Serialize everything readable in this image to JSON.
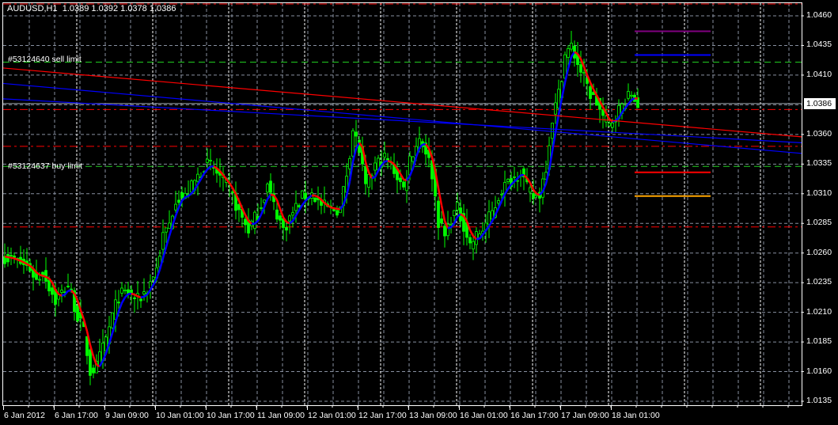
{
  "header": {
    "symbol": "AUDUSD,H1",
    "open": "1.0389",
    "high": "1.0392",
    "low": "1.0378",
    "close": "1.0386"
  },
  "orders": [
    {
      "label": "#53124640 sell limit",
      "price": 1.0421,
      "color": "#22cc22"
    },
    {
      "label": "#53124637 buy limit",
      "price": 1.0333,
      "color": "#22cc22"
    }
  ],
  "current_price": "1.0386",
  "colors": {
    "bull": "#00ff00",
    "ma_up": "#0000ff",
    "ma_down": "#ff0000",
    "grid": "#8890a0",
    "separator": "#ffffff"
  },
  "chart_data": {
    "type": "candlestick",
    "title": "AUDUSD,H1",
    "timeframe_hours": 1,
    "ylim": [
      1.0125,
      1.0471
    ],
    "y_ticks": [
      "1.0460",
      "1.0435",
      "1.0410",
      "1.0385",
      "1.0360",
      "1.0335",
      "1.0310",
      "1.0285",
      "1.0260",
      "1.0235",
      "1.0210",
      "1.0185",
      "1.0160",
      "1.0135"
    ],
    "y_tick_labels": [
      "1.0460",
      "1.0435",
      "1.0410",
      "1.0360",
      "1.0335",
      "1.0310",
      "1.0285",
      "1.0260",
      "1.0235",
      "1.0210",
      "1.0185",
      "1.0160",
      "1.0135"
    ],
    "x_tick_labels": [
      "6 Jan 2012",
      "6 Jan 17:00",
      "9 Jan 09:00",
      "10 Jan 01:00",
      "10 Jan 17:00",
      "11 Jan 09:00",
      "12 Jan 01:00",
      "12 Jan 17:00",
      "13 Jan 09:00",
      "16 Jan 01:00",
      "16 Jan 17:00",
      "17 Jan 09:00",
      "18 Jan 01:00"
    ],
    "close_path_bar_price": [
      [
        0,
        1.0257
      ],
      [
        4,
        1.0253
      ],
      [
        8,
        1.0247
      ],
      [
        10,
        1.0237
      ],
      [
        12,
        1.0244
      ],
      [
        16,
        1.022
      ],
      [
        20,
        1.0233
      ],
      [
        23,
        1.0207
      ],
      [
        25,
        1.0193
      ],
      [
        27,
        1.016
      ],
      [
        29,
        1.0164
      ],
      [
        32,
        1.0187
      ],
      [
        34,
        1.0207
      ],
      [
        36,
        1.0224
      ],
      [
        39,
        1.0227
      ],
      [
        42,
        1.022
      ],
      [
        45,
        1.023
      ],
      [
        48,
        1.0247
      ],
      [
        50,
        1.0274
      ],
      [
        52,
        1.0284
      ],
      [
        54,
        1.0307
      ],
      [
        57,
        1.0307
      ],
      [
        60,
        1.032
      ],
      [
        63,
        1.0334
      ],
      [
        65,
        1.0334
      ],
      [
        68,
        1.0324
      ],
      [
        71,
        1.0314
      ],
      [
        74,
        1.0294
      ],
      [
        77,
        1.028
      ],
      [
        80,
        1.0294
      ],
      [
        83,
        1.0317
      ],
      [
        85,
        1.03
      ],
      [
        88,
        1.028
      ],
      [
        91,
        1.0294
      ],
      [
        94,
        1.0307
      ],
      [
        97,
        1.031
      ],
      [
        100,
        1.03
      ],
      [
        103,
        1.0297
      ],
      [
        106,
        1.0297
      ],
      [
        108,
        1.0327
      ],
      [
        110,
        1.0364
      ],
      [
        112,
        1.0347
      ],
      [
        114,
        1.0314
      ],
      [
        117,
        1.0334
      ],
      [
        120,
        1.034
      ],
      [
        123,
        1.033
      ],
      [
        126,
        1.0314
      ],
      [
        128,
        1.034
      ],
      [
        131,
        1.0357
      ],
      [
        133,
        1.0347
      ],
      [
        135,
        1.0327
      ],
      [
        137,
        1.0287
      ],
      [
        139,
        1.0274
      ],
      [
        141,
        1.029
      ],
      [
        143,
        1.0297
      ],
      [
        145,
        1.0284
      ],
      [
        147,
        1.0267
      ],
      [
        149,
        1.0274
      ],
      [
        151,
        1.028
      ],
      [
        154,
        1.0294
      ],
      [
        157,
        1.0314
      ],
      [
        161,
        1.0324
      ],
      [
        163,
        1.033
      ],
      [
        165,
        1.0314
      ],
      [
        167,
        1.0307
      ],
      [
        169,
        1.031
      ],
      [
        171,
        1.0334
      ],
      [
        173,
        1.0374
      ],
      [
        175,
        1.0394
      ],
      [
        177,
        1.0427
      ],
      [
        179,
        1.0434
      ],
      [
        181,
        1.042
      ],
      [
        183,
        1.0407
      ],
      [
        185,
        1.0394
      ],
      [
        187,
        1.0387
      ],
      [
        189,
        1.0374
      ],
      [
        191,
        1.0367
      ],
      [
        193,
        1.0377
      ],
      [
        195,
        1.0384
      ],
      [
        198,
        1.0394
      ],
      [
        200,
        1.0386
      ]
    ],
    "trendlines": [
      {
        "name": "red-trendline",
        "color": "#ff0000",
        "from_price": 1.0416,
        "to_price": 1.0358
      },
      {
        "name": "blue-trendline-lower",
        "color": "#0000ff",
        "from_price": 1.0403,
        "to_price": 1.0344
      },
      {
        "name": "blue-trendline-upper",
        "color": "#0000ff",
        "from_price": 1.039,
        "to_price": 1.0353
      }
    ],
    "hlines": [
      {
        "name": "red-dashdot-top",
        "price": 1.047,
        "color": "#ff0000"
      },
      {
        "name": "red-dashdot-1",
        "price": 1.0381,
        "color": "#ff0000"
      },
      {
        "name": "red-dashdot-2",
        "price": 1.035,
        "color": "#ff0000"
      },
      {
        "name": "red-dashdot-3",
        "price": 1.0282,
        "color": "#ff0000"
      }
    ],
    "legend_swatches": [
      {
        "name": "purple-swatch",
        "color": "#800080",
        "price": 1.0447
      },
      {
        "name": "blue-swatch",
        "color": "#0000ff",
        "price": 1.0427
      },
      {
        "name": "red-swatch",
        "color": "#ff0000",
        "price": 1.0328
      },
      {
        "name": "orange-swatch",
        "color": "#ffa500",
        "price": 1.0308
      }
    ],
    "legend": "top-right"
  }
}
